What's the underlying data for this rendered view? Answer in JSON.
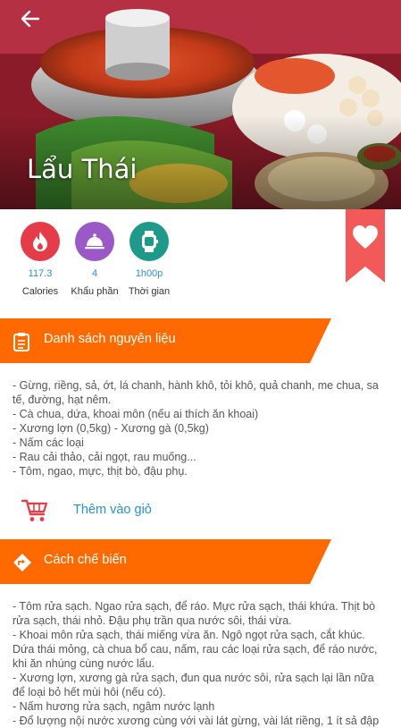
{
  "recipe": {
    "title": "Lẩu Thái"
  },
  "stats": [
    {
      "value": "117.3",
      "label": "Calories",
      "icon": "flame-icon",
      "color": "#e53c4a"
    },
    {
      "value": "4",
      "label": "Khẩu phần",
      "icon": "serving-dish-icon",
      "color": "#9b59c7"
    },
    {
      "value": "1h00p",
      "label": "Thời gian",
      "icon": "watch-icon",
      "color": "#1f9a8a"
    }
  ],
  "ingredients": {
    "title": "Danh sách nguyên liệu",
    "lines": [
      "- Gừng, riềng, sả, ớt, lá chanh, hành khô, tỏi khô, quả chanh, me chua, sa tế, đường, hạt nêm.",
      "- Cà chua, dứa, khoai môn (nếu ai thích ăn khoai)",
      "- Xương lợn (0,5kg) - Xương gà (0,5kg)",
      "- Nấm các loại",
      "- Rau cải thảo, cải ngọt, rau muống...",
      "- Tôm, ngao, mực, thịt bò, đậu phụ."
    ]
  },
  "cart": {
    "label": "Thêm vào giỏ"
  },
  "steps": {
    "title": "Cách chế biến",
    "lines": [
      "- Tôm rửa sạch. Ngao rửa sạch, để ráo. Mực rửa sạch, thái khứa. Thịt bò rửa sạch, thái nhỏ. Đậu phụ trần qua nước sôi, thái vừa.",
      "- Khoai môn rửa sạch, thái miếng vừa ăn. Ngô ngọt rửa sạch, cắt khúc. Dứa thái mỏng, cà chua bổ cau, nấm, rau các loại rửa sạch, để ráo nước, khi ăn nhúng cùng nước lẩu.",
      "- Xương lợn, xương gà rửa sạch, đun qua nước sôi, rửa sạch lại lần nữa để loại bỏ hết mùi hôi (nếu có).",
      "- Nấm hương rửa sạch, ngâm nước lạnh",
      "- Đổ lượng nội nước xương cùng với vài lát gừng, vài lát riềng, 1 ít sả đập"
    ]
  },
  "colors": {
    "accent": "#ff6a00",
    "link": "#2a8fc9",
    "favorite": "#f25a5a"
  }
}
